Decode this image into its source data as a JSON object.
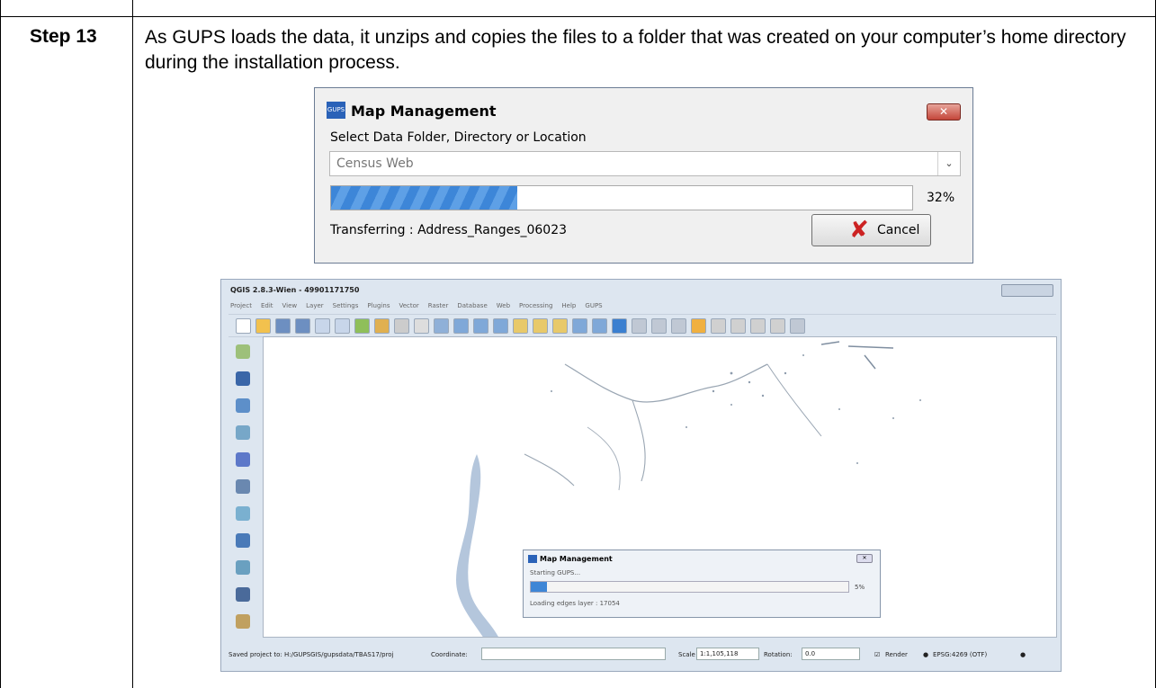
{
  "step": {
    "label": "Step 13",
    "text": "As GUPS loads the data, it unzips and copies the files to a folder that was created on your computer’s home directory during the installation process."
  },
  "dialog_main": {
    "logo_text": "GUPS",
    "title": "Map Management",
    "close_glyph": "✕",
    "select_label": "Select Data Folder, Directory or Location",
    "combo_value": "Census Web",
    "combo_arrow": "⌄",
    "progress_fraction": 0.32,
    "progress_text": "32%",
    "status_text": "Transferring : Address_Ranges_06023",
    "cancel_glyph": "✘",
    "cancel_label": "Cancel",
    "cancel_color": "#cc2222"
  },
  "qgis": {
    "title": "QGIS 2.8.3-Wien - 49901171750",
    "menu": [
      "Project",
      "Edit",
      "View",
      "Layer",
      "Settings",
      "Plugins",
      "Vector",
      "Raster",
      "Database",
      "Web",
      "Processing",
      "Help",
      "GUPS"
    ],
    "status": {
      "saved": "Saved project to: H:/GUPSGIS/gupsdata/TBAS17/proj",
      "coordinate_label": "Coordinate:",
      "coordinate_value": "",
      "scale_label": "Scale",
      "scale_value": "1:1,105,118",
      "rotation_label": "Rotation:",
      "rotation_value": "0.0",
      "render_label": "Render",
      "render_checked": true,
      "crs": "EPSG:4269 (OTF)"
    },
    "accent_color": "#3e86d6"
  },
  "dialog_inner": {
    "title": "Map Management",
    "close_glyph": "✕",
    "status_text": "Starting GUPS...",
    "progress_fraction": 0.05,
    "progress_text": "5%",
    "loading_text": "Loading edges layer : 17054"
  }
}
